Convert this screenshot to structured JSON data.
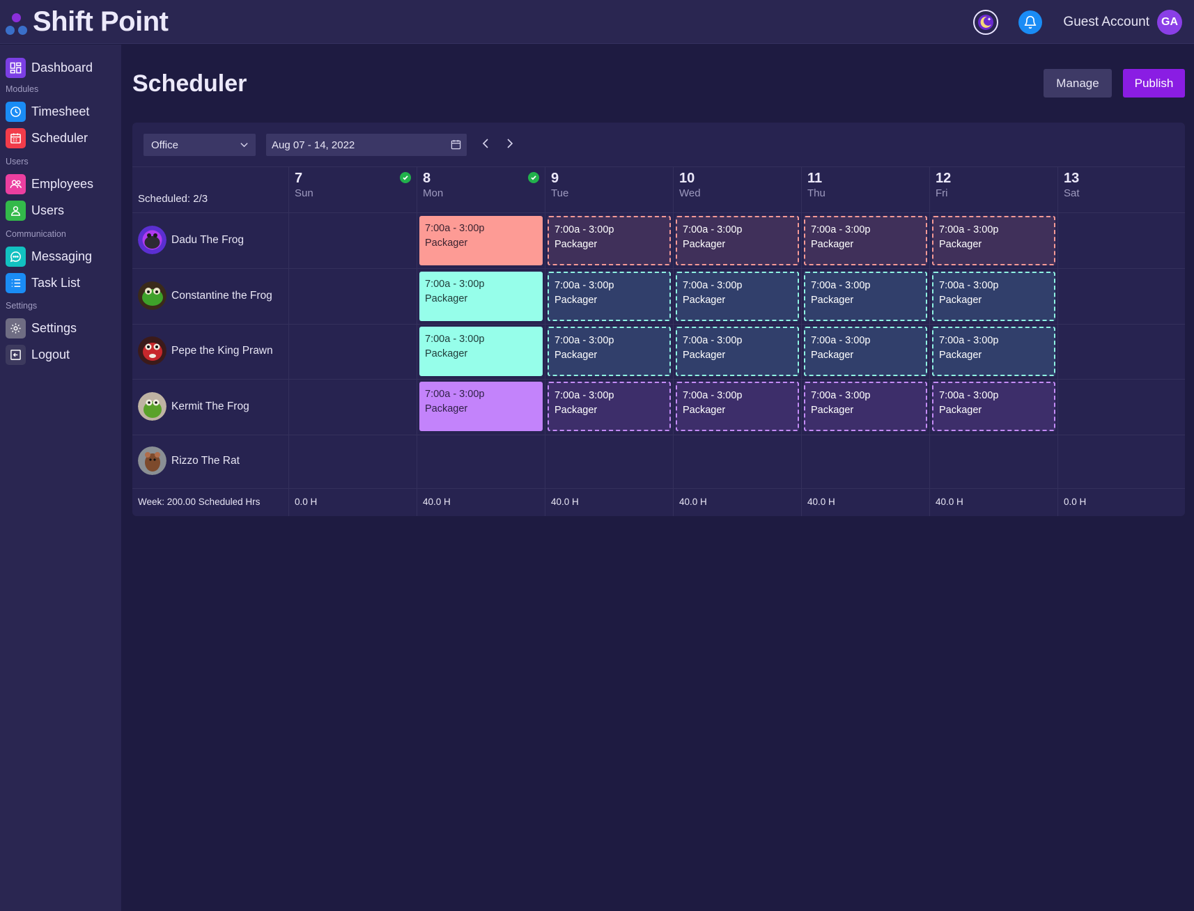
{
  "app": {
    "name": "Shift Point",
    "account_name": "Guest Account",
    "account_initials": "GA"
  },
  "sidebar": {
    "items": [
      {
        "label": "Dashboard",
        "icon": "dashboard-icon",
        "color": "#7b3fe4"
      },
      {
        "label": "Timesheet",
        "icon": "clock-icon",
        "color": "#1a8cf5"
      },
      {
        "label": "Scheduler",
        "icon": "calendar-icon",
        "color": "#f23c4a"
      },
      {
        "label": "Employees",
        "icon": "people-icon",
        "color": "#ec3fa0"
      },
      {
        "label": "Users",
        "icon": "user-icon",
        "color": "#33b94a"
      },
      {
        "label": "Messaging",
        "icon": "chat-icon",
        "color": "#12c1c1"
      },
      {
        "label": "Task List",
        "icon": "list-icon",
        "color": "#1a8cf5"
      },
      {
        "label": "Settings",
        "icon": "gear-icon",
        "color": "#6f6d83"
      },
      {
        "label": "Logout",
        "icon": "logout-icon",
        "color": "#3d3a5e"
      }
    ],
    "sections": {
      "modules": "Modules",
      "users": "Users",
      "communication": "Communication",
      "settings": "Settings"
    }
  },
  "page": {
    "title": "Scheduler",
    "manage_label": "Manage",
    "publish_label": "Publish"
  },
  "toolbar": {
    "location": "Office",
    "date_range": "Aug 07 - 14, 2022"
  },
  "schedule": {
    "scheduled_count": "Scheduled: 2/3",
    "days": [
      {
        "num": "7",
        "name": "Sun",
        "published": true
      },
      {
        "num": "8",
        "name": "Mon",
        "published": true
      },
      {
        "num": "9",
        "name": "Tue",
        "published": false
      },
      {
        "num": "10",
        "name": "Wed",
        "published": false
      },
      {
        "num": "11",
        "name": "Thu",
        "published": false
      },
      {
        "num": "12",
        "name": "Fri",
        "published": false
      },
      {
        "num": "13",
        "name": "Sat",
        "published": false
      }
    ],
    "employees": [
      {
        "name": "Dadu The Frog",
        "shift_color": "red"
      },
      {
        "name": "Constantine the Frog",
        "shift_color": "cyan"
      },
      {
        "name": "Pepe the King Prawn",
        "shift_color": "cyan"
      },
      {
        "name": "Kermit The Frog",
        "shift_color": "purple"
      },
      {
        "name": "Rizzo The Rat",
        "shift_color": ""
      }
    ],
    "shift_time": "7:00a - 3:00p",
    "shift_role": "Packager",
    "week_total": "Week: 200.00 Scheduled Hrs",
    "day_totals": [
      "0.0 H",
      "40.0 H",
      "40.0 H",
      "40.0 H",
      "40.0 H",
      "40.0 H",
      "0.0 H"
    ]
  }
}
